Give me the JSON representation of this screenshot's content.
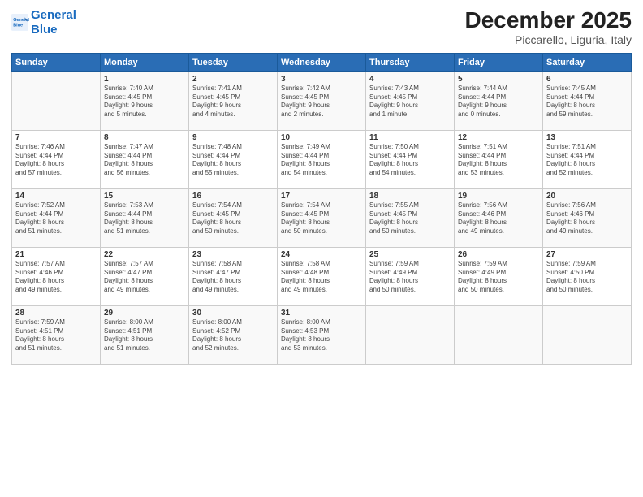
{
  "header": {
    "logo_line1": "General",
    "logo_line2": "Blue",
    "title": "December 2025",
    "subtitle": "Piccarello, Liguria, Italy"
  },
  "columns": [
    "Sunday",
    "Monday",
    "Tuesday",
    "Wednesday",
    "Thursday",
    "Friday",
    "Saturday"
  ],
  "weeks": [
    [
      {
        "day": "",
        "info": ""
      },
      {
        "day": "1",
        "info": "Sunrise: 7:40 AM\nSunset: 4:45 PM\nDaylight: 9 hours\nand 5 minutes."
      },
      {
        "day": "2",
        "info": "Sunrise: 7:41 AM\nSunset: 4:45 PM\nDaylight: 9 hours\nand 4 minutes."
      },
      {
        "day": "3",
        "info": "Sunrise: 7:42 AM\nSunset: 4:45 PM\nDaylight: 9 hours\nand 2 minutes."
      },
      {
        "day": "4",
        "info": "Sunrise: 7:43 AM\nSunset: 4:45 PM\nDaylight: 9 hours\nand 1 minute."
      },
      {
        "day": "5",
        "info": "Sunrise: 7:44 AM\nSunset: 4:44 PM\nDaylight: 9 hours\nand 0 minutes."
      },
      {
        "day": "6",
        "info": "Sunrise: 7:45 AM\nSunset: 4:44 PM\nDaylight: 8 hours\nand 59 minutes."
      }
    ],
    [
      {
        "day": "7",
        "info": "Sunrise: 7:46 AM\nSunset: 4:44 PM\nDaylight: 8 hours\nand 57 minutes."
      },
      {
        "day": "8",
        "info": "Sunrise: 7:47 AM\nSunset: 4:44 PM\nDaylight: 8 hours\nand 56 minutes."
      },
      {
        "day": "9",
        "info": "Sunrise: 7:48 AM\nSunset: 4:44 PM\nDaylight: 8 hours\nand 55 minutes."
      },
      {
        "day": "10",
        "info": "Sunrise: 7:49 AM\nSunset: 4:44 PM\nDaylight: 8 hours\nand 54 minutes."
      },
      {
        "day": "11",
        "info": "Sunrise: 7:50 AM\nSunset: 4:44 PM\nDaylight: 8 hours\nand 54 minutes."
      },
      {
        "day": "12",
        "info": "Sunrise: 7:51 AM\nSunset: 4:44 PM\nDaylight: 8 hours\nand 53 minutes."
      },
      {
        "day": "13",
        "info": "Sunrise: 7:51 AM\nSunset: 4:44 PM\nDaylight: 8 hours\nand 52 minutes."
      }
    ],
    [
      {
        "day": "14",
        "info": "Sunrise: 7:52 AM\nSunset: 4:44 PM\nDaylight: 8 hours\nand 51 minutes."
      },
      {
        "day": "15",
        "info": "Sunrise: 7:53 AM\nSunset: 4:44 PM\nDaylight: 8 hours\nand 51 minutes."
      },
      {
        "day": "16",
        "info": "Sunrise: 7:54 AM\nSunset: 4:45 PM\nDaylight: 8 hours\nand 50 minutes."
      },
      {
        "day": "17",
        "info": "Sunrise: 7:54 AM\nSunset: 4:45 PM\nDaylight: 8 hours\nand 50 minutes."
      },
      {
        "day": "18",
        "info": "Sunrise: 7:55 AM\nSunset: 4:45 PM\nDaylight: 8 hours\nand 50 minutes."
      },
      {
        "day": "19",
        "info": "Sunrise: 7:56 AM\nSunset: 4:46 PM\nDaylight: 8 hours\nand 49 minutes."
      },
      {
        "day": "20",
        "info": "Sunrise: 7:56 AM\nSunset: 4:46 PM\nDaylight: 8 hours\nand 49 minutes."
      }
    ],
    [
      {
        "day": "21",
        "info": "Sunrise: 7:57 AM\nSunset: 4:46 PM\nDaylight: 8 hours\nand 49 minutes."
      },
      {
        "day": "22",
        "info": "Sunrise: 7:57 AM\nSunset: 4:47 PM\nDaylight: 8 hours\nand 49 minutes."
      },
      {
        "day": "23",
        "info": "Sunrise: 7:58 AM\nSunset: 4:47 PM\nDaylight: 8 hours\nand 49 minutes."
      },
      {
        "day": "24",
        "info": "Sunrise: 7:58 AM\nSunset: 4:48 PM\nDaylight: 8 hours\nand 49 minutes."
      },
      {
        "day": "25",
        "info": "Sunrise: 7:59 AM\nSunset: 4:49 PM\nDaylight: 8 hours\nand 50 minutes."
      },
      {
        "day": "26",
        "info": "Sunrise: 7:59 AM\nSunset: 4:49 PM\nDaylight: 8 hours\nand 50 minutes."
      },
      {
        "day": "27",
        "info": "Sunrise: 7:59 AM\nSunset: 4:50 PM\nDaylight: 8 hours\nand 50 minutes."
      }
    ],
    [
      {
        "day": "28",
        "info": "Sunrise: 7:59 AM\nSunset: 4:51 PM\nDaylight: 8 hours\nand 51 minutes."
      },
      {
        "day": "29",
        "info": "Sunrise: 8:00 AM\nSunset: 4:51 PM\nDaylight: 8 hours\nand 51 minutes."
      },
      {
        "day": "30",
        "info": "Sunrise: 8:00 AM\nSunset: 4:52 PM\nDaylight: 8 hours\nand 52 minutes."
      },
      {
        "day": "31",
        "info": "Sunrise: 8:00 AM\nSunset: 4:53 PM\nDaylight: 8 hours\nand 53 minutes."
      },
      {
        "day": "",
        "info": ""
      },
      {
        "day": "",
        "info": ""
      },
      {
        "day": "",
        "info": ""
      }
    ]
  ]
}
